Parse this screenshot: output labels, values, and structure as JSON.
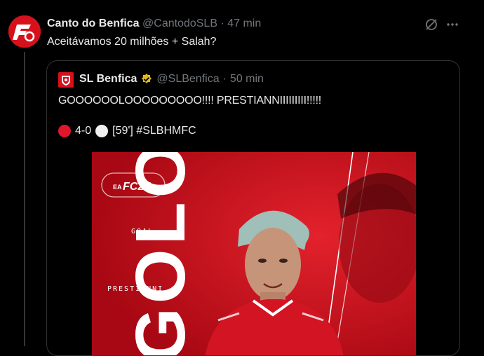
{
  "tweet": {
    "author_name": "Canto do Benfica",
    "handle": "@CantodoSLB",
    "separator": "·",
    "time": "47 min",
    "text": "Aceitávamos 20 milhões + Salah?"
  },
  "quoted": {
    "author_name": "SL Benfica",
    "handle": "@SLBenfica",
    "separator": "·",
    "time": "50 min",
    "text_line1": "GOOOOOOLOOOOOOOOO!!!! PRESTIANNIIIIIIIII!!!!!",
    "score": "4-0",
    "match_info": "[59'] #SLBHMFC",
    "media": {
      "brand": "FC27",
      "brand_prefix": "EA",
      "label_goal": "GOAL",
      "label_player": "PRESTIANNI",
      "big_text": "GOLO"
    }
  },
  "icons": [
    "grok-icon",
    "more-icon",
    "verified-icon"
  ],
  "colors": {
    "background": "#000000",
    "text": "#e7e9ea",
    "muted": "#71767b",
    "benfica_red": "#d6101d",
    "verified_gold": "#e2b719"
  }
}
